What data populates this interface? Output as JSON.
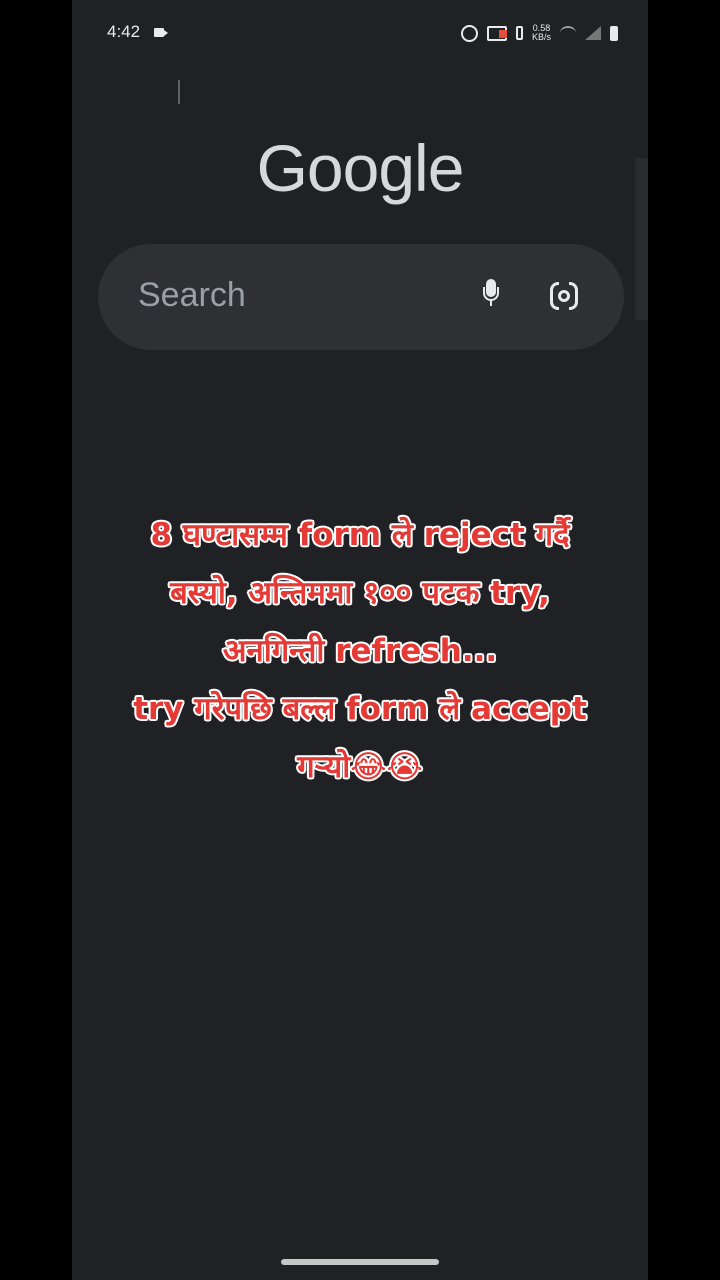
{
  "status_bar": {
    "time": "4:42",
    "net_speed_value": "0.58",
    "net_speed_unit": "KB/s"
  },
  "google_logo": "Google",
  "search": {
    "placeholder": "Search",
    "icons": [
      "mic-icon",
      "lens-icon"
    ]
  },
  "caption_lines": [
    "8 घण्टासम्म form ले reject गर्दै",
    "बस्यो, अन्तिममा  १०० पटक try,",
    "अनगिन्ती refresh...",
    "try गरेपछि बल्ल form ले accept",
    "गर्‍यो😂😭"
  ],
  "colors": {
    "background": "#202124",
    "caption_text": "#e53935",
    "caption_outline": "#ffffff"
  }
}
